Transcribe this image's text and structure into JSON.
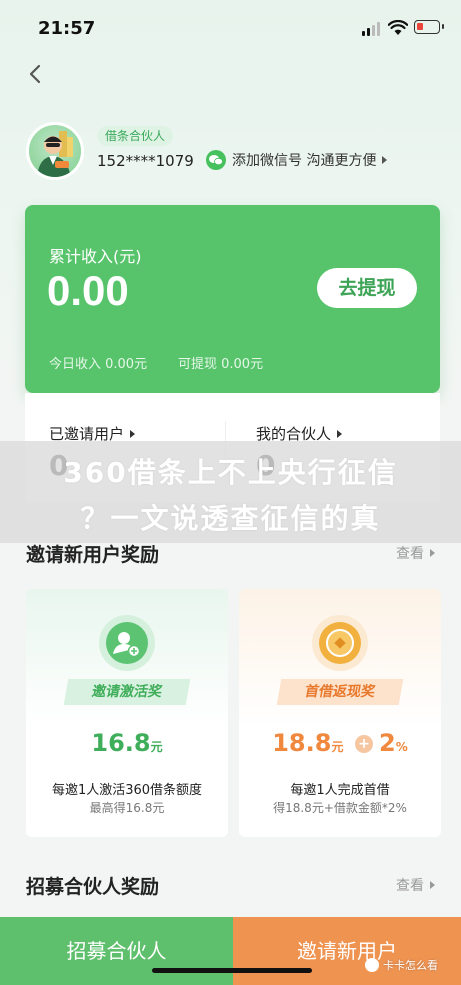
{
  "status_bar": {
    "time": "21:57"
  },
  "profile": {
    "badge": "借条合伙人",
    "phone": "152****1079",
    "wechat_link": "添加微信号 沟通更方便"
  },
  "income": {
    "label": "累计收入(元)",
    "amount": "0.00",
    "withdraw": "去提现",
    "today": "今日收入 0.00元",
    "available": "可提现 0.00元"
  },
  "stats": {
    "invited_label": "已邀请用户",
    "invited_value": "0",
    "partners_label": "我的合伙人",
    "partners_value": "0"
  },
  "banner": {
    "line1": "360借条上不上央行征信",
    "line2": "？一文说透查征信的真"
  },
  "invite_section": {
    "title": "邀请新用户奖励",
    "more": "查看"
  },
  "rewards": [
    {
      "title": "邀请激活奖",
      "value": "16.8",
      "unit": "元",
      "desc": "每邀1人激活360借条额度",
      "sub": "最高得16.8元",
      "color": "#3fae5a"
    },
    {
      "title": "首借返现奖",
      "value": "18.8",
      "unit": "元",
      "plus": "+",
      "value2": "2",
      "unit2": "%",
      "desc": "每邀1人完成首借",
      "sub": "得18.8元+借款金额*2%",
      "color": "#f0883e"
    }
  ],
  "recruit_section": {
    "title": "招募合伙人奖励",
    "more": "查看"
  },
  "bottom": {
    "left": "招募合伙人",
    "right": "邀请新用户"
  },
  "watermark": "卡卡怎么看"
}
